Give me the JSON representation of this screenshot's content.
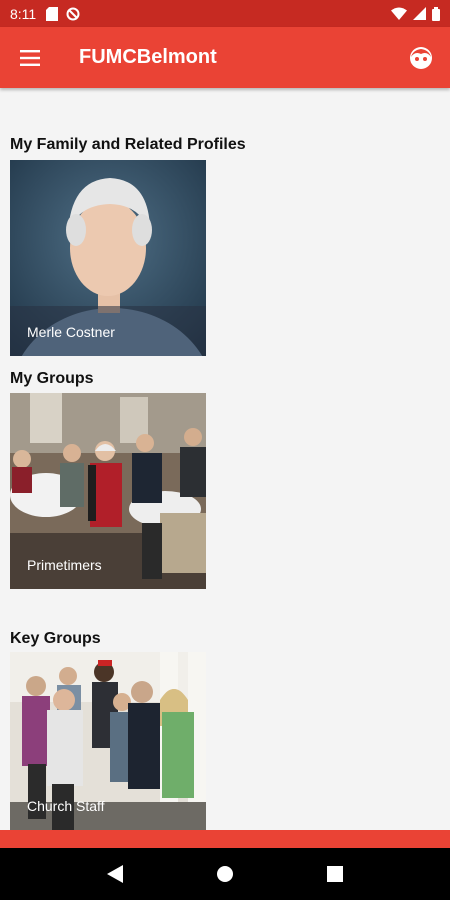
{
  "status": {
    "time": "8:11"
  },
  "app": {
    "title": "FUMCBelmont"
  },
  "sections": {
    "family": {
      "title": "My Family and Related Profiles",
      "cards": [
        {
          "label": "Merle Costner"
        }
      ]
    },
    "groups": {
      "title": "My Groups",
      "cards": [
        {
          "label": "Primetimers"
        }
      ]
    },
    "key_groups": {
      "title": "Key Groups",
      "cards": [
        {
          "label": "Church Staff"
        }
      ]
    }
  },
  "colors": {
    "status_bar": "#c62a22",
    "app_bar": "#ea4335",
    "background": "#f4f4f4"
  }
}
